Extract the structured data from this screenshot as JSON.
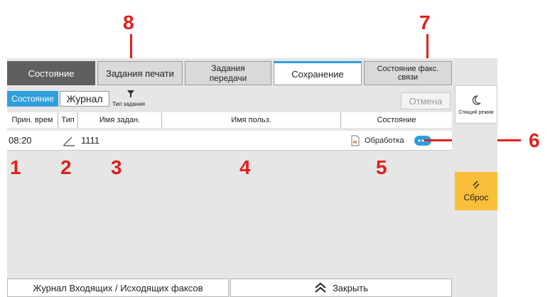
{
  "tabs": [
    {
      "label": "Состояние"
    },
    {
      "label": "Задания печати"
    },
    {
      "label": "Задания передачи"
    },
    {
      "label": "Сохранение"
    },
    {
      "label": "Состояние факс. связи"
    }
  ],
  "toolbar": {
    "status_toggle": "Состояние",
    "log_toggle": "Журнал",
    "job_type_filter": "Тип задания",
    "cancel_label": "Отмена"
  },
  "table": {
    "columns": [
      "Прин. врем",
      "Тип",
      "Имя задан.",
      "Имя польз.",
      "Состояние"
    ],
    "rows": [
      {
        "time": "08:20",
        "type_icon": "pencil-icon",
        "job_name": "1111",
        "user_name": "",
        "status": "Обработка"
      }
    ]
  },
  "bottom": {
    "fax_log_label": "Журнал Входящих / Исходящих факсов",
    "close_label": "Закрыть"
  },
  "side": {
    "sleep_label": "Спящий режим",
    "reset_label": "Сброс"
  },
  "callouts": [
    "1",
    "2",
    "3",
    "4",
    "5",
    "6",
    "7",
    "8"
  ],
  "colors": {
    "accent": "#2e9fdc",
    "callout": "#e0201b",
    "reset_button": "#f9bf3b",
    "active_tab": "#5f5f5f"
  }
}
